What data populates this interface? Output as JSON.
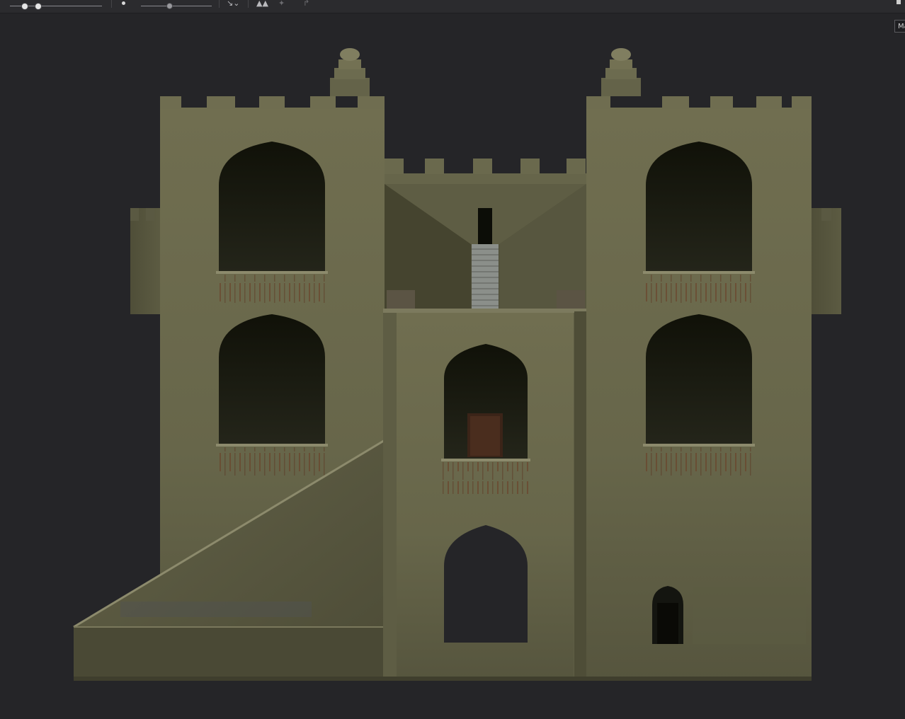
{
  "toolbar": {
    "icons": [
      "brush-size-slider",
      "brush-strength-slider",
      "point-icon",
      "opacity-slider",
      "selection-tool-icon",
      "symmetry-icon",
      "transform-icon",
      "redo-arrow-icon"
    ],
    "slider_1_value": 0.12,
    "slider_2_value": 0.37,
    "opacity_slider_value": 0.4
  },
  "viewport": {
    "mode_button_label": "Ma",
    "scene": "castle-gatehouse-elevation",
    "colors": {
      "background": "#252528",
      "stone": "#6b6a4b",
      "stone_dark": "#4e4e38",
      "opening": "#17180f",
      "rust": "#6b3a22"
    }
  }
}
